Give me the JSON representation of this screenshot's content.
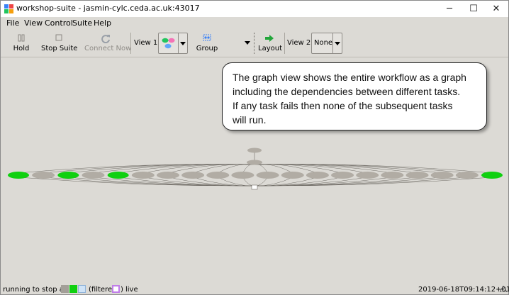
{
  "window": {
    "title": "workshop-suite - jasmin-cylc.ceda.ac.uk:43017",
    "minimize": "─",
    "maximize": "☐",
    "close": "✕"
  },
  "menu": {
    "file": "File",
    "view": "View",
    "control": "Control",
    "suite": "Suite",
    "help": "Help"
  },
  "toolbar": {
    "hold": "Hold",
    "stop_suite": "Stop Suite",
    "connect_now": "Connect Now",
    "view1_label": "View 1:",
    "group": "Group",
    "layout": "Layout",
    "view2_label": "View 2:",
    "view2_value": "None"
  },
  "callout": {
    "line1": "The graph view shows the entire workflow  as a graph",
    "line2": "including the dependencies between different tasks.",
    "line3": "If any task fails then none of the subsequent tasks",
    "line4": "will run."
  },
  "graph": {
    "colors": {
      "succeeded": "#10d010",
      "waiting": "#b1aca4",
      "edge": "#6e6a64"
    },
    "row_states": [
      "succeeded",
      "waiting",
      "succeeded",
      "waiting",
      "succeeded",
      "waiting",
      "waiting",
      "waiting",
      "waiting",
      "waiting",
      "waiting",
      "waiting",
      "waiting",
      "waiting",
      "waiting",
      "waiting",
      "waiting",
      "waiting",
      "waiting",
      "succeeded"
    ]
  },
  "status": {
    "running_text": "running to stop at 1",
    "filtered_text": "(filtered:",
    "filtered_close": ")",
    "live": "live",
    "timestamp": "2019-06-18T09:14:12+01:00",
    "colors": {
      "swatch1": "#a39f98",
      "swatch2": "#10d010",
      "swatch3": "#cfe3f7",
      "filter": "#c07ee8"
    }
  }
}
